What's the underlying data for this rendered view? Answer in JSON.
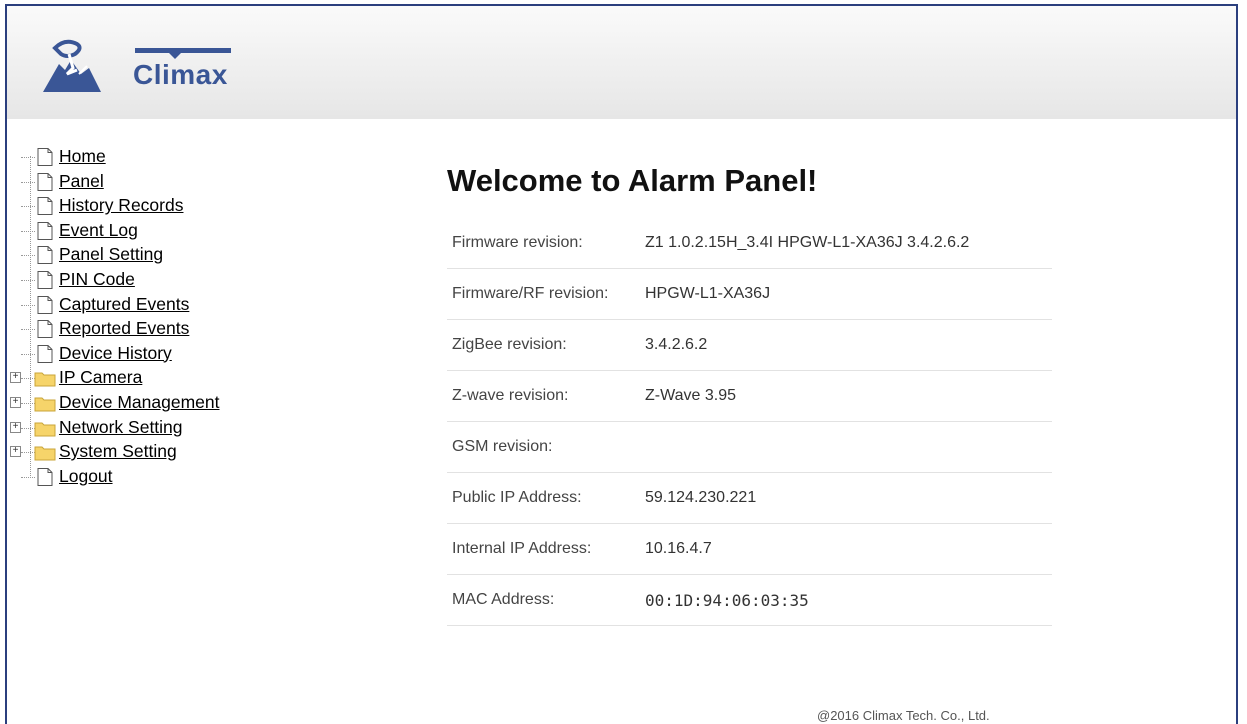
{
  "brand": {
    "logo_text": "Climax",
    "accent": "#3a5696",
    "frame_color": "#2b3f7e"
  },
  "sidebar": {
    "items": [
      {
        "label": "Home",
        "type": "page"
      },
      {
        "label": "Panel",
        "type": "page"
      },
      {
        "label": "History Records",
        "type": "page"
      },
      {
        "label": "Event Log",
        "type": "page"
      },
      {
        "label": "Panel Setting",
        "type": "page"
      },
      {
        "label": "PIN Code",
        "type": "page"
      },
      {
        "label": "Captured Events",
        "type": "page"
      },
      {
        "label": "Reported Events",
        "type": "page"
      },
      {
        "label": "Device History",
        "type": "page"
      },
      {
        "label": "IP Camera",
        "type": "folder"
      },
      {
        "label": "Device Management",
        "type": "folder"
      },
      {
        "label": "Network Setting",
        "type": "folder"
      },
      {
        "label": "System Setting",
        "type": "folder"
      },
      {
        "label": "Logout",
        "type": "page"
      }
    ]
  },
  "main": {
    "title": "Welcome to Alarm Panel!",
    "rows": [
      {
        "label": "Firmware revision:",
        "value": "Z1 1.0.2.15H_3.4I HPGW-L1-XA36J 3.4.2.6.2"
      },
      {
        "label": "Firmware/RF revision:",
        "value": "HPGW-L1-XA36J"
      },
      {
        "label": "ZigBee revision:",
        "value": "3.4.2.6.2"
      },
      {
        "label": "Z-wave revision:",
        "value": "Z-Wave 3.95"
      },
      {
        "label": "GSM revision:",
        "value": ""
      },
      {
        "label": "Public IP Address:",
        "value": "59.124.230.221"
      },
      {
        "label": "Internal IP Address:",
        "value": "10.16.4.7"
      },
      {
        "label": "MAC Address:",
        "value": "00:1D:94:06:03:35"
      }
    ]
  },
  "footer": {
    "copyright": "@2016 Climax Tech. Co., Ltd."
  }
}
